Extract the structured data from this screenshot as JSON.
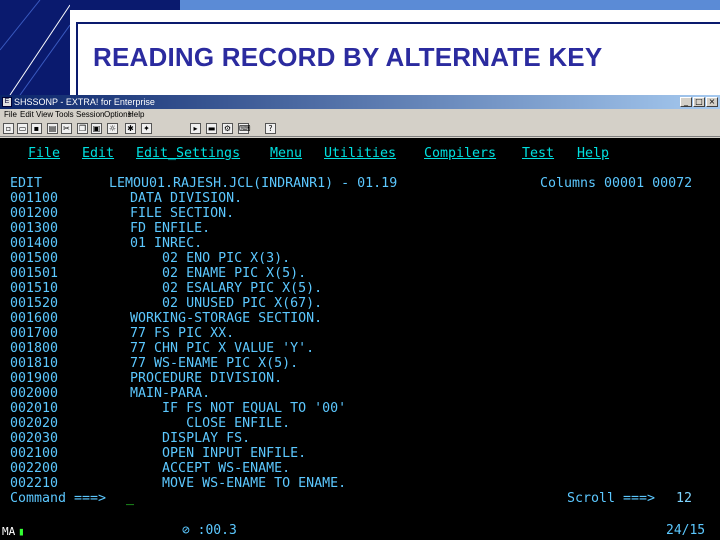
{
  "slide": {
    "title": "READING RECORD BY ALTERNATE KEY"
  },
  "window": {
    "title": "SHSSONP - EXTRA! for Enterprise",
    "buttons": {
      "minimize": "_",
      "maximize": "□",
      "close": "×"
    },
    "menu": [
      "File",
      "Edit",
      "View",
      "Tools",
      "Session",
      "Options",
      "Help"
    ],
    "toolbar_icons": [
      "new-icon",
      "open-icon",
      "save-icon",
      "print-icon",
      "cut-icon",
      "copy-icon",
      "paste-icon",
      "macro-icon",
      "record-icon",
      "stop-icon",
      "play-icon",
      "tools-icon",
      "settings-icon",
      "help-icon"
    ]
  },
  "terminal": {
    "menu": [
      "File",
      "Edit",
      "Edit_Settings",
      "Menu",
      "Utilities",
      "Compilers",
      "Test",
      "Help"
    ],
    "header": {
      "mode": "EDIT",
      "dataset": "LEMOU01.RAJESH.JCL(INDRANR1) - 01.19",
      "columns": "Columns 00001 00072"
    },
    "lines": [
      {
        "no": "001100",
        "text": "     DATA DIVISION."
      },
      {
        "no": "001200",
        "text": "     FILE SECTION."
      },
      {
        "no": "001300",
        "text": "     FD ENFILE."
      },
      {
        "no": "001400",
        "text": "     01 INREC."
      },
      {
        "no": "001500",
        "text": "         02 ENO PIC X(3)."
      },
      {
        "no": "001501",
        "text": "         02 ENAME PIC X(5)."
      },
      {
        "no": "001510",
        "text": "         02 ESALARY PIC X(5)."
      },
      {
        "no": "001520",
        "text": "         02 UNUSED PIC X(67)."
      },
      {
        "no": "001600",
        "text": "     WORKING-STORAGE SECTION."
      },
      {
        "no": "001700",
        "text": "     77 FS PIC XX."
      },
      {
        "no": "001800",
        "text": "     77 CHN PIC X VALUE 'Y'."
      },
      {
        "no": "001810",
        "text": "     77 WS-ENAME PIC X(5)."
      },
      {
        "no": "001900",
        "text": "     PROCEDURE DIVISION."
      },
      {
        "no": "002000",
        "text": "     MAIN-PARA."
      },
      {
        "no": "002010",
        "text": "         IF FS NOT EQUAL TO '00'"
      },
      {
        "no": "002020",
        "text": "            CLOSE ENFILE."
      },
      {
        "no": "002030",
        "text": "         DISPLAY FS."
      },
      {
        "no": "002100",
        "text": "         OPEN INPUT ENFILE."
      },
      {
        "no": "002200",
        "text": "         ACCEPT WS-ENAME."
      },
      {
        "no": "002210",
        "text": "         MOVE WS-ENAME TO ENAME."
      }
    ],
    "command_label": "Command ===>",
    "command_value": "_",
    "scroll_label": "Scroll ===>",
    "scroll_value": "12"
  },
  "status": {
    "left": "MA",
    "indicator": "▮",
    "timer": "⊘ :00.3",
    "position": "24/15"
  }
}
